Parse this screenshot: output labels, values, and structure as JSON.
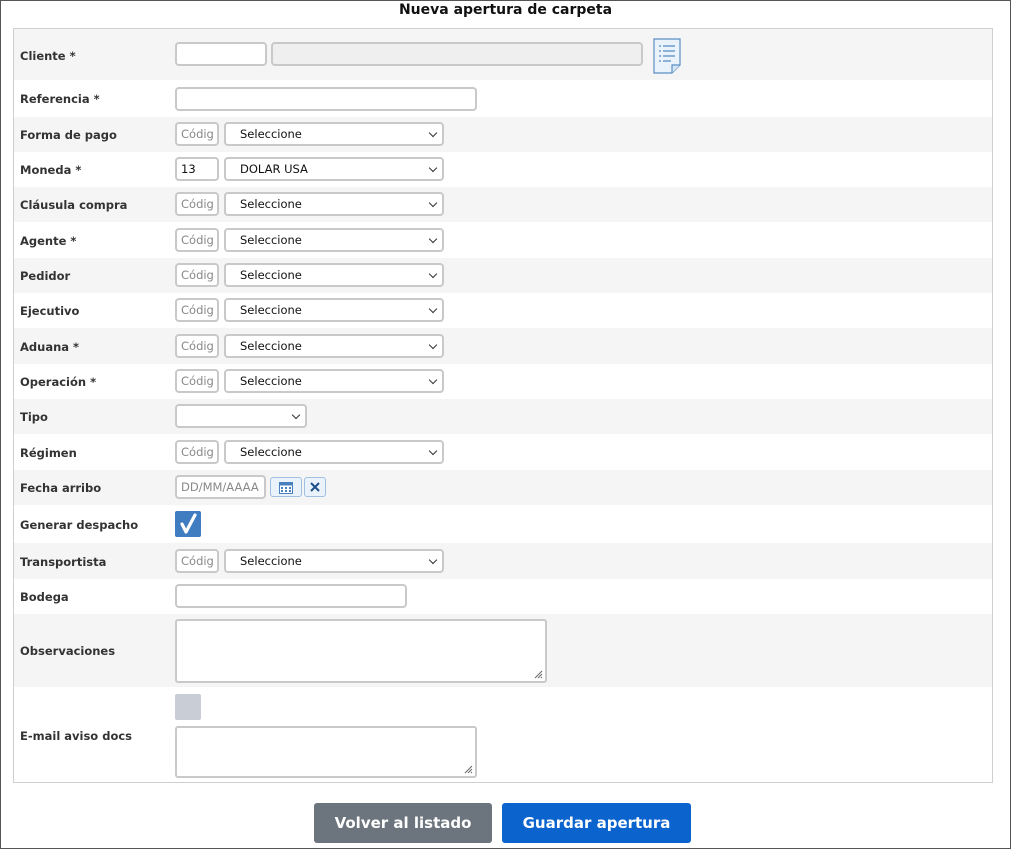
{
  "title": "Nueva apertura de carpeta",
  "code_placeholder": "Códig",
  "select_default": "Seleccione",
  "fields": {
    "cliente": {
      "label": "Cliente *"
    },
    "referencia": {
      "label": "Referencia *"
    },
    "forma_pago": {
      "label": "Forma de pago"
    },
    "moneda": {
      "label": "Moneda *",
      "code": "13",
      "value": "DOLAR USA"
    },
    "clausula": {
      "label": "Cláusula compra"
    },
    "agente": {
      "label": "Agente *"
    },
    "pedidor": {
      "label": "Pedidor"
    },
    "ejecutivo": {
      "label": "Ejecutivo"
    },
    "aduana": {
      "label": "Aduana *"
    },
    "operacion": {
      "label": "Operación *"
    },
    "tipo": {
      "label": "Tipo",
      "value": ""
    },
    "regimen": {
      "label": "Régimen"
    },
    "fecha_arribo": {
      "label": "Fecha arribo",
      "placeholder": "DD/MM/AAAA"
    },
    "generar_despacho": {
      "label": "Generar despacho",
      "checked": true
    },
    "transportista": {
      "label": "Transportista"
    },
    "bodega": {
      "label": "Bodega"
    },
    "observaciones": {
      "label": "Observaciones"
    },
    "email_aviso": {
      "label": "E-mail aviso docs",
      "checked": false
    }
  },
  "icons": {
    "client_list": "document-list-icon",
    "calendar": "calendar-icon",
    "clear": "close-icon"
  },
  "buttons": {
    "back": "Volver al listado",
    "save": "Guardar apertura"
  },
  "colors": {
    "primary": "#0b63ce",
    "secondary": "#6c757d",
    "checkbox": "#3f7cc0"
  }
}
